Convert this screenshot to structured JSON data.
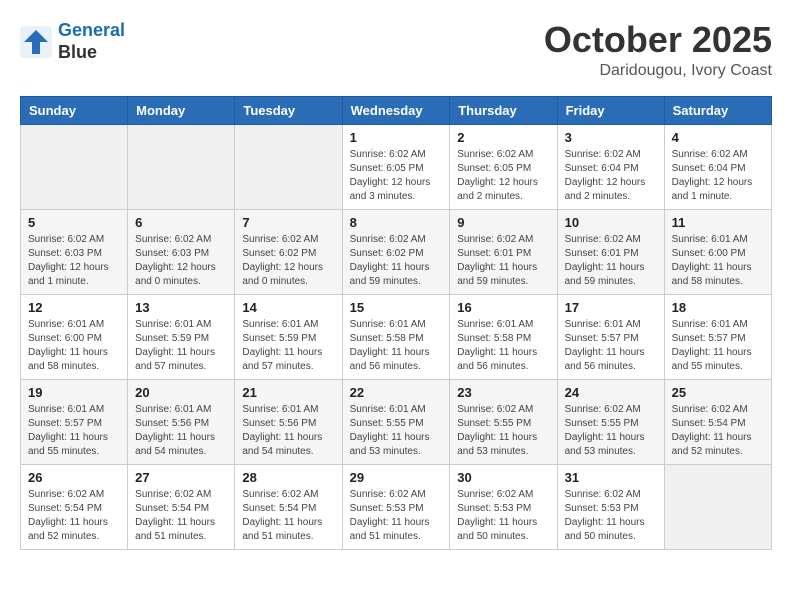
{
  "header": {
    "logo_line1": "General",
    "logo_line2": "Blue",
    "month": "October 2025",
    "location": "Daridougou, Ivory Coast"
  },
  "days_of_week": [
    "Sunday",
    "Monday",
    "Tuesday",
    "Wednesday",
    "Thursday",
    "Friday",
    "Saturday"
  ],
  "weeks": [
    [
      {
        "num": "",
        "info": ""
      },
      {
        "num": "",
        "info": ""
      },
      {
        "num": "",
        "info": ""
      },
      {
        "num": "1",
        "info": "Sunrise: 6:02 AM\nSunset: 6:05 PM\nDaylight: 12 hours\nand 3 minutes."
      },
      {
        "num": "2",
        "info": "Sunrise: 6:02 AM\nSunset: 6:05 PM\nDaylight: 12 hours\nand 2 minutes."
      },
      {
        "num": "3",
        "info": "Sunrise: 6:02 AM\nSunset: 6:04 PM\nDaylight: 12 hours\nand 2 minutes."
      },
      {
        "num": "4",
        "info": "Sunrise: 6:02 AM\nSunset: 6:04 PM\nDaylight: 12 hours\nand 1 minute."
      }
    ],
    [
      {
        "num": "5",
        "info": "Sunrise: 6:02 AM\nSunset: 6:03 PM\nDaylight: 12 hours\nand 1 minute."
      },
      {
        "num": "6",
        "info": "Sunrise: 6:02 AM\nSunset: 6:03 PM\nDaylight: 12 hours\nand 0 minutes."
      },
      {
        "num": "7",
        "info": "Sunrise: 6:02 AM\nSunset: 6:02 PM\nDaylight: 12 hours\nand 0 minutes."
      },
      {
        "num": "8",
        "info": "Sunrise: 6:02 AM\nSunset: 6:02 PM\nDaylight: 11 hours\nand 59 minutes."
      },
      {
        "num": "9",
        "info": "Sunrise: 6:02 AM\nSunset: 6:01 PM\nDaylight: 11 hours\nand 59 minutes."
      },
      {
        "num": "10",
        "info": "Sunrise: 6:02 AM\nSunset: 6:01 PM\nDaylight: 11 hours\nand 59 minutes."
      },
      {
        "num": "11",
        "info": "Sunrise: 6:01 AM\nSunset: 6:00 PM\nDaylight: 11 hours\nand 58 minutes."
      }
    ],
    [
      {
        "num": "12",
        "info": "Sunrise: 6:01 AM\nSunset: 6:00 PM\nDaylight: 11 hours\nand 58 minutes."
      },
      {
        "num": "13",
        "info": "Sunrise: 6:01 AM\nSunset: 5:59 PM\nDaylight: 11 hours\nand 57 minutes."
      },
      {
        "num": "14",
        "info": "Sunrise: 6:01 AM\nSunset: 5:59 PM\nDaylight: 11 hours\nand 57 minutes."
      },
      {
        "num": "15",
        "info": "Sunrise: 6:01 AM\nSunset: 5:58 PM\nDaylight: 11 hours\nand 56 minutes."
      },
      {
        "num": "16",
        "info": "Sunrise: 6:01 AM\nSunset: 5:58 PM\nDaylight: 11 hours\nand 56 minutes."
      },
      {
        "num": "17",
        "info": "Sunrise: 6:01 AM\nSunset: 5:57 PM\nDaylight: 11 hours\nand 56 minutes."
      },
      {
        "num": "18",
        "info": "Sunrise: 6:01 AM\nSunset: 5:57 PM\nDaylight: 11 hours\nand 55 minutes."
      }
    ],
    [
      {
        "num": "19",
        "info": "Sunrise: 6:01 AM\nSunset: 5:57 PM\nDaylight: 11 hours\nand 55 minutes."
      },
      {
        "num": "20",
        "info": "Sunrise: 6:01 AM\nSunset: 5:56 PM\nDaylight: 11 hours\nand 54 minutes."
      },
      {
        "num": "21",
        "info": "Sunrise: 6:01 AM\nSunset: 5:56 PM\nDaylight: 11 hours\nand 54 minutes."
      },
      {
        "num": "22",
        "info": "Sunrise: 6:01 AM\nSunset: 5:55 PM\nDaylight: 11 hours\nand 53 minutes."
      },
      {
        "num": "23",
        "info": "Sunrise: 6:02 AM\nSunset: 5:55 PM\nDaylight: 11 hours\nand 53 minutes."
      },
      {
        "num": "24",
        "info": "Sunrise: 6:02 AM\nSunset: 5:55 PM\nDaylight: 11 hours\nand 53 minutes."
      },
      {
        "num": "25",
        "info": "Sunrise: 6:02 AM\nSunset: 5:54 PM\nDaylight: 11 hours\nand 52 minutes."
      }
    ],
    [
      {
        "num": "26",
        "info": "Sunrise: 6:02 AM\nSunset: 5:54 PM\nDaylight: 11 hours\nand 52 minutes."
      },
      {
        "num": "27",
        "info": "Sunrise: 6:02 AM\nSunset: 5:54 PM\nDaylight: 11 hours\nand 51 minutes."
      },
      {
        "num": "28",
        "info": "Sunrise: 6:02 AM\nSunset: 5:54 PM\nDaylight: 11 hours\nand 51 minutes."
      },
      {
        "num": "29",
        "info": "Sunrise: 6:02 AM\nSunset: 5:53 PM\nDaylight: 11 hours\nand 51 minutes."
      },
      {
        "num": "30",
        "info": "Sunrise: 6:02 AM\nSunset: 5:53 PM\nDaylight: 11 hours\nand 50 minutes."
      },
      {
        "num": "31",
        "info": "Sunrise: 6:02 AM\nSunset: 5:53 PM\nDaylight: 11 hours\nand 50 minutes."
      },
      {
        "num": "",
        "info": ""
      }
    ]
  ]
}
